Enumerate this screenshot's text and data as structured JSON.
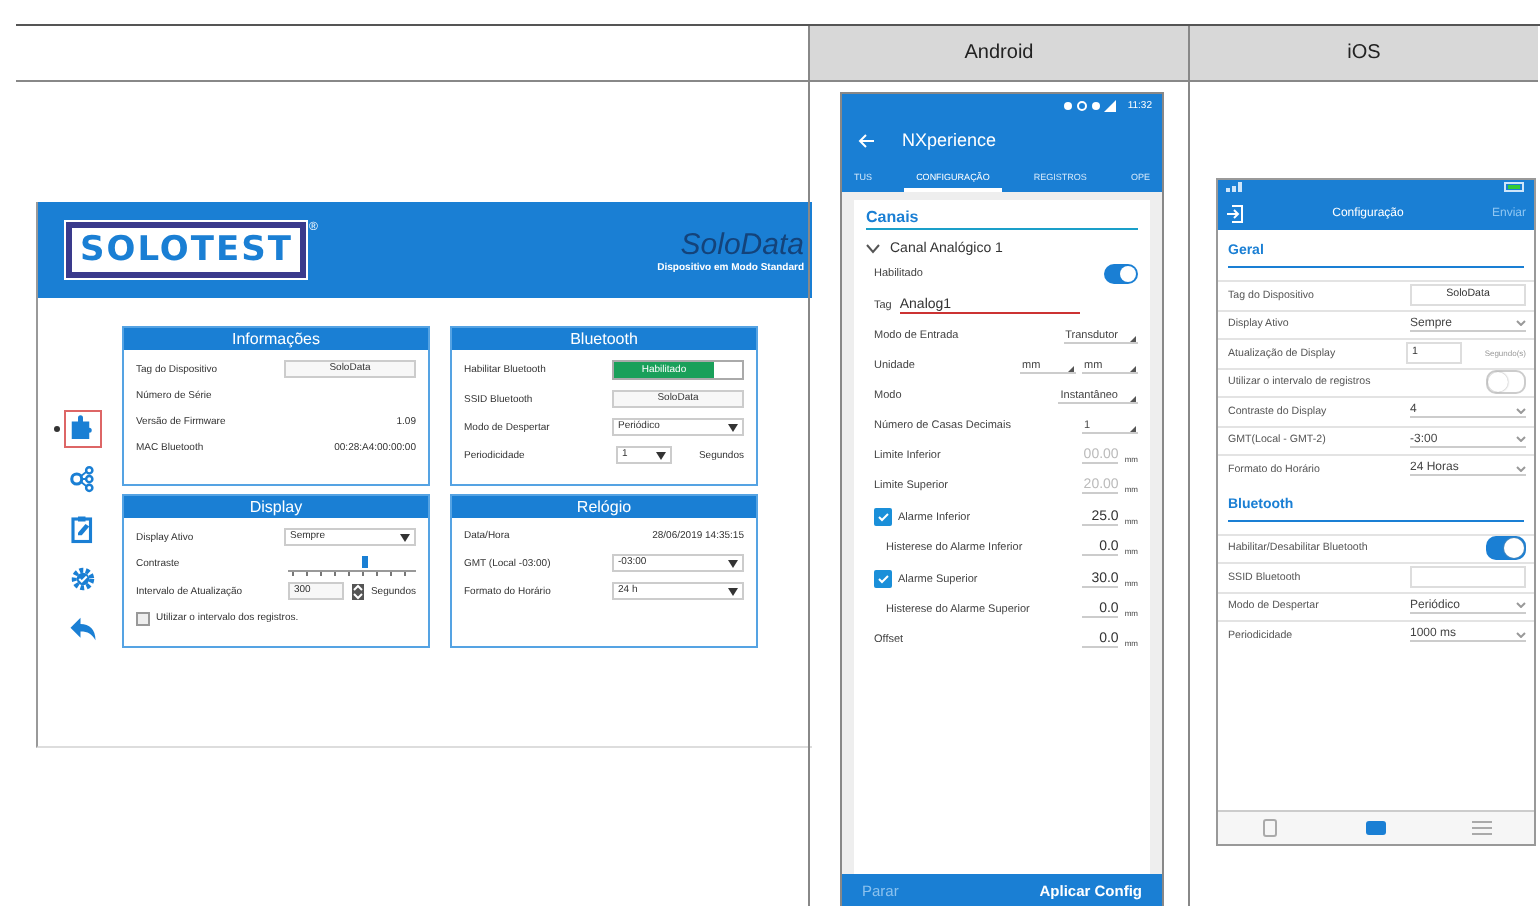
{
  "columns": [
    {
      "label": "Android"
    },
    {
      "label": "iOS"
    }
  ],
  "desktop": {
    "logo": "SOLOTEST",
    "logo_mark": "®",
    "product": "SoloData",
    "subtitle": "Dispositivo em Modo Standard",
    "nav": [
      {
        "selected": true
      },
      {
        "selected": false
      },
      {
        "selected": false
      },
      {
        "selected": false
      },
      {
        "selected": false
      }
    ],
    "panels": [
      {
        "title": "Informações",
        "rows": [
          {
            "kind": "field",
            "label": "Tag do Dispositivo",
            "value": "SoloData"
          },
          {
            "kind": "text",
            "label": "Número de Série"
          },
          {
            "kind": "text",
            "label": "Versão de Firmware",
            "value": "1.09"
          },
          {
            "kind": "text",
            "label": "MAC Bluetooth",
            "value": "00:28:A4:00:00:00"
          }
        ]
      },
      {
        "title": "Bluetooth",
        "rows": [
          {
            "kind": "toggle",
            "label": "Habilitar Bluetooth",
            "value": "Habilitado",
            "on": true
          },
          {
            "kind": "field",
            "label": "SSID Bluetooth",
            "value": "SoloData"
          },
          {
            "kind": "select",
            "label": "Modo de Despertar",
            "value": "Periódico"
          },
          {
            "kind": "select",
            "label": "Periodicidade",
            "value": "1",
            "unit": "Segundos"
          }
        ]
      },
      {
        "title": "Display",
        "rows": [
          {
            "kind": "select",
            "label": "Display Ativo",
            "value": "Sempre"
          },
          {
            "kind": "slider",
            "label": "Contraste",
            "level": 0.6
          },
          {
            "kind": "spin",
            "label": "Intervalo de Atualização",
            "value": "300",
            "unit": "Segundos"
          },
          {
            "kind": "check",
            "label": "Utilizar o intervalo dos registros.",
            "checked": false
          }
        ]
      },
      {
        "title": "Relógio",
        "rows": [
          {
            "kind": "text",
            "label": "Data/Hora",
            "value": "28/06/2019 14:35:15"
          },
          {
            "kind": "select",
            "label": "GMT (Local -03:00)",
            "value": "-03:00"
          },
          {
            "kind": "select",
            "label": "Formato do Horário",
            "value": "24 h"
          }
        ]
      }
    ]
  },
  "android": {
    "time": "11:32",
    "title": "NXperience",
    "tabs": [
      {
        "label": "TUS",
        "selected": false
      },
      {
        "label": "CONFIGURAÇÃO",
        "selected": true
      },
      {
        "label": "REGISTROS",
        "selected": false
      },
      {
        "label": "OPE",
        "selected": false
      }
    ],
    "section": "Canais",
    "channel": {
      "label": "Canal Analógico 1",
      "expanded": true
    },
    "rows": [
      {
        "kind": "toggle",
        "label": "Habilitado",
        "on": true
      },
      {
        "kind": "field",
        "label": "Tag",
        "value": "Analog1"
      },
      {
        "kind": "select",
        "label": "Modo de Entrada",
        "values": [
          "Transdutor"
        ]
      },
      {
        "kind": "select",
        "label": "Unidade",
        "values": [
          "mm",
          "mm"
        ]
      },
      {
        "kind": "select",
        "label": "Modo",
        "values": [
          "Instantâneo"
        ]
      },
      {
        "kind": "select",
        "label": "Número de Casas Decimais",
        "values": [
          "1"
        ]
      },
      {
        "kind": "value",
        "label": "Limite Inferior",
        "value": "00.00",
        "unit": "mm",
        "disabled": true
      },
      {
        "kind": "value",
        "label": "Limite Superior",
        "value": "20.00",
        "unit": "mm",
        "disabled": true
      },
      {
        "kind": "alarm",
        "label": "Alarme Inferior",
        "value": "25.0",
        "unit": "mm",
        "checked": true,
        "children": [
          {
            "kind": "value",
            "label": "Histerese do Alarme Inferior",
            "value": "0.0",
            "unit": "mm",
            "disabled": false
          }
        ]
      },
      {
        "kind": "alarm",
        "label": "Alarme Superior",
        "value": "30.0",
        "unit": "mm",
        "checked": true,
        "children": [
          {
            "kind": "value",
            "label": "Histerese do Alarme Superior",
            "value": "0.0",
            "unit": "mm",
            "disabled": false
          }
        ]
      },
      {
        "kind": "value",
        "label": "Offset",
        "value": "0.0",
        "unit": "mm",
        "disabled": false
      }
    ],
    "buttons": [
      {
        "label": "Parar",
        "disabled": true
      },
      {
        "label": "Aplicar Config",
        "disabled": false
      }
    ]
  },
  "ios": {
    "title": "Configuração",
    "action": "Enviar",
    "sections": [
      {
        "title": "Geral",
        "rows": [
          {
            "kind": "field",
            "label": "Tag do Dispositivo",
            "value": "SoloData"
          },
          {
            "kind": "select",
            "label": "Display Ativo",
            "value": "Sempre"
          },
          {
            "kind": "field",
            "label": "Atualização de Display",
            "value": "1",
            "unit": "Segundo(s)"
          },
          {
            "kind": "toggle",
            "label": "Utilizar o intervalo de registros",
            "on": false
          },
          {
            "kind": "select",
            "label": "Contraste do Display",
            "value": "4"
          },
          {
            "kind": "select",
            "label": "GMT(Local - GMT-2)",
            "value": "-3:00"
          },
          {
            "kind": "select",
            "label": "Formato do Horário",
            "value": "24 Horas"
          }
        ]
      },
      {
        "title": "Bluetooth",
        "rows": [
          {
            "kind": "toggle",
            "label": "Habilitar/Desabilitar Bluetooth",
            "on": true
          },
          {
            "kind": "field",
            "label": "SSID Bluetooth"
          },
          {
            "kind": "select",
            "label": "Modo de Despertar",
            "value": "Periódico"
          },
          {
            "kind": "select",
            "label": "Periodicidade",
            "value": "1000 ms"
          }
        ]
      }
    ],
    "tabbar": [
      {
        "selected": false
      },
      {
        "selected": true
      },
      {
        "selected": false
      }
    ]
  }
}
